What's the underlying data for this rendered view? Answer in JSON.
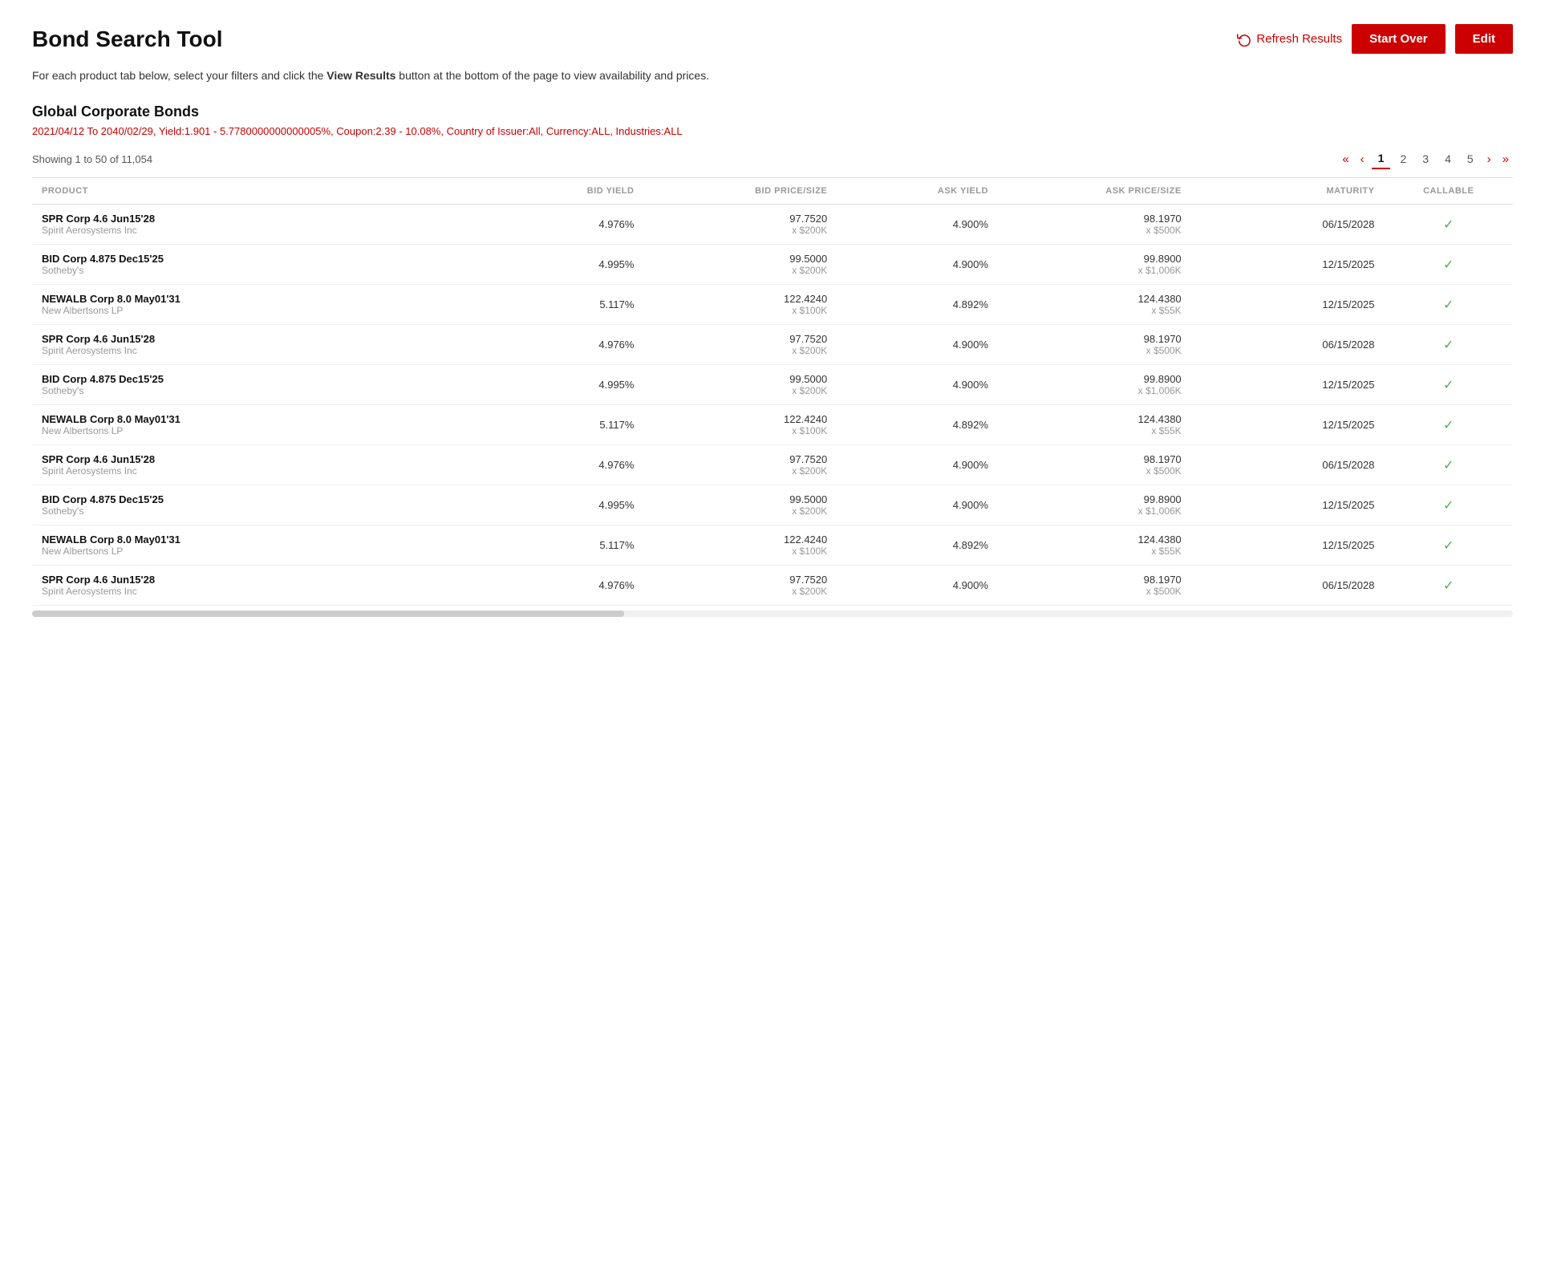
{
  "page": {
    "title": "Bond Search Tool",
    "description_part1": "For each product tab below, select your filters and click the ",
    "description_bold": "View Results",
    "description_part2": " button at the bottom of the page to view availability and prices."
  },
  "header": {
    "refresh_label": "Refresh Results",
    "start_over_label": "Start Over",
    "edit_label": "Edit"
  },
  "section": {
    "title": "Global Corporate Bonds",
    "filter_summary": "2021/04/12 To 2040/02/29, Yield:1.901 - 5.7780000000000005%, Coupon:2.39 - 10.08%, Country of Issuer:All, Currency:ALL, Industries:ALL"
  },
  "results": {
    "showing": "Showing 1 to 50 of 11,054"
  },
  "pagination": {
    "pages": [
      "1",
      "2",
      "3",
      "4",
      "5"
    ]
  },
  "table": {
    "headers": [
      "PRODUCT",
      "BID YIELD",
      "BID PRICE/SIZE",
      "ASK YIELD",
      "ASK PRICE/SIZE",
      "MATURITY",
      "CALLABLE"
    ],
    "rows": [
      {
        "product_name": "SPR Corp 4.6 Jun15'28",
        "product_issuer": "Spirit Aerosystems Inc",
        "bid_yield": "4.976%",
        "bid_price": "97.7520",
        "bid_size": "x $200K",
        "ask_yield": "4.900%",
        "ask_price": "98.1970",
        "ask_size": "x $500K",
        "maturity": "06/15/2028",
        "callable": true
      },
      {
        "product_name": "BID Corp 4.875 Dec15'25",
        "product_issuer": "Sotheby's",
        "bid_yield": "4.995%",
        "bid_price": "99.5000",
        "bid_size": "x $200K",
        "ask_yield": "4.900%",
        "ask_price": "99.8900",
        "ask_size": "x $1,006K",
        "maturity": "12/15/2025",
        "callable": true
      },
      {
        "product_name": "NEWALB Corp 8.0 May01'31",
        "product_issuer": "New Albertsons LP",
        "bid_yield": "5.117%",
        "bid_price": "122.4240",
        "bid_size": "x $100K",
        "ask_yield": "4.892%",
        "ask_price": "124.4380",
        "ask_size": "x $55K",
        "maturity": "12/15/2025",
        "callable": true
      },
      {
        "product_name": "SPR Corp 4.6 Jun15'28",
        "product_issuer": "Spirit Aerosystems Inc",
        "bid_yield": "4.976%",
        "bid_price": "97.7520",
        "bid_size": "x $200K",
        "ask_yield": "4.900%",
        "ask_price": "98.1970",
        "ask_size": "x $500K",
        "maturity": "06/15/2028",
        "callable": true
      },
      {
        "product_name": "BID Corp 4.875 Dec15'25",
        "product_issuer": "Sotheby's",
        "bid_yield": "4.995%",
        "bid_price": "99.5000",
        "bid_size": "x $200K",
        "ask_yield": "4.900%",
        "ask_price": "99.8900",
        "ask_size": "x $1,006K",
        "maturity": "12/15/2025",
        "callable": true
      },
      {
        "product_name": "NEWALB Corp 8.0 May01'31",
        "product_issuer": "New Albertsons LP",
        "bid_yield": "5.117%",
        "bid_price": "122.4240",
        "bid_size": "x $100K",
        "ask_yield": "4.892%",
        "ask_price": "124.4380",
        "ask_size": "x $55K",
        "maturity": "12/15/2025",
        "callable": true
      },
      {
        "product_name": "SPR Corp 4.6 Jun15'28",
        "product_issuer": "Spirit Aerosystems Inc",
        "bid_yield": "4.976%",
        "bid_price": "97.7520",
        "bid_size": "x $200K",
        "ask_yield": "4.900%",
        "ask_price": "98.1970",
        "ask_size": "x $500K",
        "maturity": "06/15/2028",
        "callable": true
      },
      {
        "product_name": "BID Corp 4.875 Dec15'25",
        "product_issuer": "Sotheby's",
        "bid_yield": "4.995%",
        "bid_price": "99.5000",
        "bid_size": "x $200K",
        "ask_yield": "4.900%",
        "ask_price": "99.8900",
        "ask_size": "x $1,006K",
        "maturity": "12/15/2025",
        "callable": true
      },
      {
        "product_name": "NEWALB Corp 8.0 May01'31",
        "product_issuer": "New Albertsons LP",
        "bid_yield": "5.117%",
        "bid_price": "122.4240",
        "bid_size": "x $100K",
        "ask_yield": "4.892%",
        "ask_price": "124.4380",
        "ask_size": "x $55K",
        "maturity": "12/15/2025",
        "callable": true
      },
      {
        "product_name": "SPR Corp 4.6 Jun15'28",
        "product_issuer": "Spirit Aerosystems Inc",
        "bid_yield": "4.976%",
        "bid_price": "97.7520",
        "bid_size": "x $200K",
        "ask_yield": "4.900%",
        "ask_price": "98.1970",
        "ask_size": "x $500K",
        "maturity": "06/15/2028",
        "callable": true
      }
    ]
  }
}
